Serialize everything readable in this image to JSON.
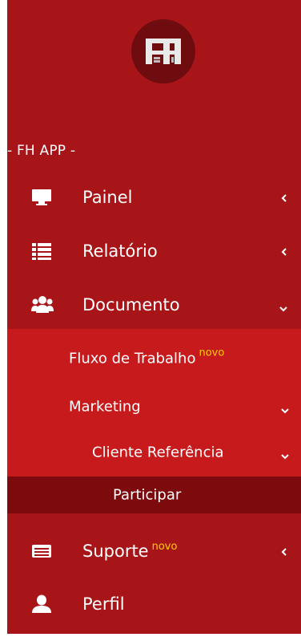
{
  "app": {
    "logo_text": "FH",
    "header": "- FH APP -"
  },
  "menu": {
    "painel": {
      "label": "Painel",
      "icon": "monitor-icon"
    },
    "relatorio": {
      "label": "Relatório",
      "icon": "list-icon"
    },
    "documento": {
      "label": "Documento",
      "icon": "users-icon"
    },
    "suporte": {
      "label": "Suporte",
      "badge": "novo",
      "icon": "card-icon"
    },
    "perfil": {
      "label": "Perfil",
      "icon": "user-icon"
    }
  },
  "submenu": {
    "fluxo": {
      "label": "Fluxo de Trabalho",
      "badge": "novo"
    },
    "marketing": {
      "label": "Marketing"
    },
    "cliente": {
      "label": "Cliente Referência"
    },
    "participar": {
      "label": "Participar"
    }
  },
  "colors": {
    "sidebar_bg": "#a81519",
    "submenu_bg": "#c61a1c",
    "active_bg": "#7d0b0e",
    "badge": "#ffcc00"
  }
}
